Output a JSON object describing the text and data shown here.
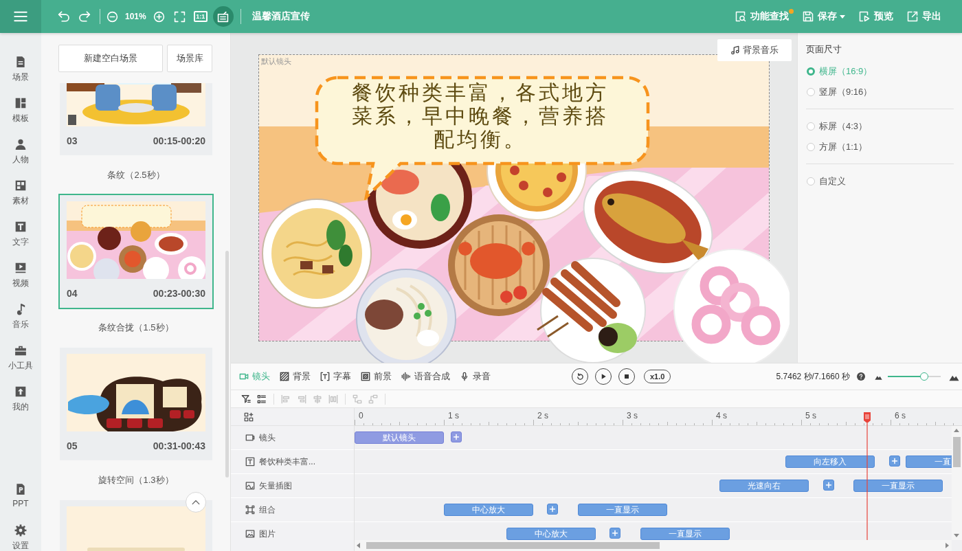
{
  "top_bar": {
    "history": [
      {
        "kind": "undo"
      },
      {
        "kind": "redo"
      }
    ],
    "zoom": {
      "value": "101%"
    },
    "view_tools": [
      {
        "kind": "fullscreen",
        "selected": false
      },
      {
        "kind": "actual_size",
        "label": "1:1",
        "selected": false
      },
      {
        "kind": "board",
        "selected": true
      }
    ],
    "title": "温馨酒店宣传",
    "actions": [
      {
        "kind": "search",
        "label": "功能查找",
        "notification": true
      },
      {
        "kind": "save",
        "label": "保存",
        "dropdown": true
      },
      {
        "kind": "preview",
        "label": "预览"
      },
      {
        "kind": "export",
        "label": "导出"
      }
    ]
  },
  "nav": {
    "main": [
      {
        "kind": "scene",
        "label": "场景"
      },
      {
        "kind": "template",
        "label": "模板"
      },
      {
        "kind": "person",
        "label": "人物"
      },
      {
        "kind": "material",
        "label": "素材"
      },
      {
        "kind": "text",
        "label": "文字"
      },
      {
        "kind": "video",
        "label": "视频"
      },
      {
        "kind": "music",
        "label": "音乐"
      },
      {
        "kind": "tools",
        "label": "小工具"
      },
      {
        "kind": "mine",
        "label": "我的"
      }
    ],
    "footer": [
      {
        "kind": "ppt",
        "label": "PPT"
      },
      {
        "kind": "settings",
        "label": "设置"
      }
    ]
  },
  "scene_panel": {
    "buttons": [
      "新建空白场景",
      "场景库"
    ],
    "items": [
      {
        "kind": "scene",
        "number": "03",
        "time": "00:15-00:20",
        "selected": false
      },
      {
        "kind": "transition",
        "label": "条纹（2.5秒）"
      },
      {
        "kind": "scene",
        "number": "04",
        "time": "00:23-00:30",
        "selected": true
      },
      {
        "kind": "transition",
        "label": "条纹合拢（1.5秒）"
      },
      {
        "kind": "scene",
        "number": "05",
        "time": "00:31-00:43",
        "selected": false
      },
      {
        "kind": "transition",
        "label": "旋转空间（1.3秒）"
      },
      {
        "kind": "scene",
        "selected": false
      }
    ]
  },
  "canvas": {
    "music_button": "背景音乐",
    "shot_label": "默认镜头",
    "caption": "餐饮种类丰富，各式地方菜系，早中晚餐，营养搭配均衡。"
  },
  "page_size": {
    "title": "页面尺寸",
    "groups": [
      {
        "options": [
          {
            "label": "横屏（16:9）",
            "selected": true
          },
          {
            "label": "竖屏（9:16）",
            "selected": false
          }
        ]
      },
      {
        "options": [
          {
            "label": "标屏（4:3）",
            "selected": false
          },
          {
            "label": "方屏（1:1）",
            "selected": false
          }
        ]
      },
      {
        "options": [
          {
            "label": "自定义",
            "selected": false
          }
        ]
      }
    ]
  },
  "timeline": {
    "tabs": [
      {
        "kind": "shot",
        "label": "镜头",
        "selected": true
      },
      {
        "kind": "background",
        "label": "背景",
        "selected": false
      },
      {
        "kind": "subtitle",
        "label": "字幕",
        "selected": false
      },
      {
        "kind": "foreground",
        "label": "前景",
        "selected": false
      },
      {
        "kind": "tts",
        "label": "语音合成",
        "selected": false
      },
      {
        "kind": "record",
        "label": "录音",
        "selected": false
      }
    ],
    "speed": "x1.0",
    "time": "5.7462 秒/7.1660 秒",
    "zoom_slider": {
      "level": 0.69
    },
    "edit_tools": [
      {
        "tools": [
          {
            "kind": "filter",
            "disabled": false
          },
          {
            "kind": "layers",
            "disabled": false
          }
        ]
      },
      {
        "tools": [
          {
            "kind": "align_left",
            "disabled": true
          },
          {
            "kind": "align_right",
            "disabled": true
          },
          {
            "kind": "align_center",
            "disabled": true
          },
          {
            "kind": "distribute",
            "disabled": true
          }
        ]
      },
      {
        "tools": [
          {
            "kind": "stack_down",
            "disabled": true
          },
          {
            "kind": "stack_up",
            "disabled": true
          }
        ]
      }
    ],
    "ruler": [
      "0",
      "1 s",
      "2 s",
      "3 s",
      "4 s",
      "5 s",
      "6 s"
    ],
    "tracks": [
      {
        "kind": "shot",
        "label": "镜头",
        "clips": [
          {
            "kind": "clip",
            "label": "默认镜头"
          },
          {
            "kind": "add"
          }
        ]
      },
      {
        "kind": "text",
        "label": "餐饮种类丰富...",
        "clips": [
          {
            "kind": "clip",
            "label": "向左移入"
          },
          {
            "kind": "add"
          },
          {
            "kind": "clip",
            "label": "一直"
          }
        ]
      },
      {
        "kind": "vector",
        "label": "矢量插图",
        "clips": [
          {
            "kind": "clip",
            "label": "光速向右"
          },
          {
            "kind": "add"
          },
          {
            "kind": "clip",
            "label": "一直显示"
          }
        ]
      },
      {
        "kind": "group",
        "label": "组合",
        "clips": [
          {
            "kind": "clip",
            "label": "中心放大"
          },
          {
            "kind": "add"
          },
          {
            "kind": "clip",
            "label": "一直显示"
          }
        ]
      },
      {
        "kind": "image",
        "label": "图片",
        "clips": [
          {
            "kind": "clip",
            "label": "中心放大"
          },
          {
            "kind": "add"
          },
          {
            "kind": "clip",
            "label": "一直显示"
          }
        ]
      }
    ]
  }
}
